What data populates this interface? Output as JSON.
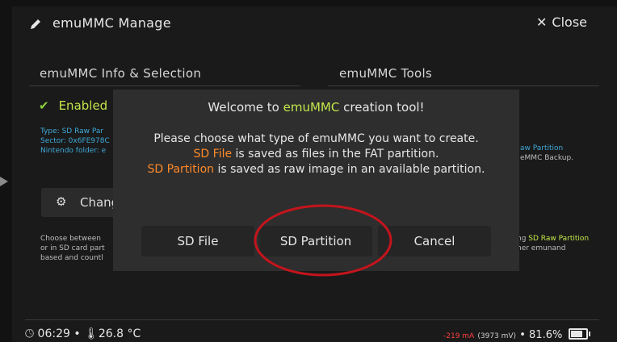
{
  "header": {
    "title": "emuMMC Manage",
    "close_label": "Close",
    "close_icon": "✕",
    "pencil_icon": "pencil-icon"
  },
  "left_section": {
    "title": "emuMMC Info & Selection",
    "enabled_label": "Enabled",
    "info_lines": [
      "Type: SD Raw Par",
      "Sector: 0x6FE978C",
      "Nintendo folder: e"
    ],
    "change_button_label": "Chang",
    "description_lines": [
      "Choose between",
      "or in SD card part",
      "based and countl"
    ]
  },
  "right_section": {
    "title": "emuMMC Tools",
    "info_lines": [
      "aw Partition",
      "eMMC Backup."
    ],
    "description_prefix": "ng ",
    "description_highlight": "SD Raw Partition",
    "description_line2": "her emunand"
  },
  "dialog": {
    "title_prefix": "Welcome to ",
    "title_highlight": "emuMMC",
    "title_suffix": " creation tool!",
    "body_line1": "Please choose what type of emuMMC you want to create.",
    "sdfile_term": "SD File",
    "sdfile_desc": " is saved as files in the FAT partition.",
    "sdpart_term": "SD Partition",
    "sdpart_desc": " is saved as raw image in an available partition.",
    "buttons": {
      "sd_file": "SD File",
      "sd_partition": "SD Partition",
      "cancel": "Cancel"
    }
  },
  "footer": {
    "time": "06:29",
    "separator": "•",
    "temperature": "26.8 °C",
    "current": "-219 mA",
    "voltage": "(3973 mV)",
    "battery_percent": "81.6%"
  },
  "colors": {
    "accent_green": "#c3e64a",
    "accent_orange": "#ff8a2a",
    "accent_blue": "#3fa9d8",
    "annotation_red": "#c4141c",
    "current_red": "#ff4040"
  }
}
